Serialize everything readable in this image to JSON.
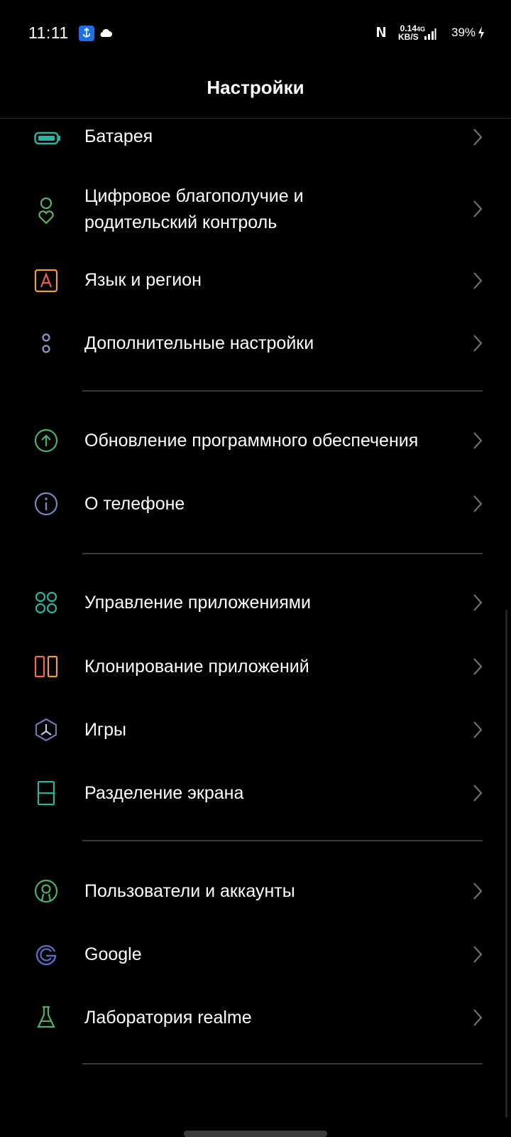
{
  "status_bar": {
    "time": "11:11",
    "net_speed_value": "0.14",
    "net_speed_unit": "KB/S",
    "network_type": "4G",
    "battery": "39%"
  },
  "header": {
    "title": "Настройки"
  },
  "items": [
    {
      "label": "Батарея",
      "icon": "battery-icon",
      "color": "#2bb5a0"
    },
    {
      "label": "Цифровое благополучие и",
      "label2": "родительский контроль",
      "icon": "wellbeing-icon",
      "color": "#5fb06a"
    },
    {
      "label": "Язык и регион",
      "icon": "language-icon",
      "color": "#f0a030"
    },
    {
      "label": "Дополнительные настройки",
      "icon": "more-settings-icon",
      "color": "#8a9ac0"
    },
    {
      "label": "Обновление программного обеспечения",
      "icon": "software-update-icon",
      "color": "#4caf6a"
    },
    {
      "label": "О телефоне",
      "icon": "info-icon",
      "color": "#7a86c0"
    },
    {
      "label": "Управление приложениями",
      "icon": "app-management-icon",
      "color": "#26b5a5"
    },
    {
      "label": "Клонирование приложений",
      "icon": "app-clone-icon",
      "color": "#f07040"
    },
    {
      "label": "Игры",
      "icon": "games-icon",
      "color": "#6a78b0"
    },
    {
      "label": "Разделение экрана",
      "icon": "split-screen-icon",
      "color": "#26b5a5"
    },
    {
      "label": "Пользователи и аккаунты",
      "icon": "users-accounts-icon",
      "color": "#4caf6a"
    },
    {
      "label": "Google",
      "icon": "google-icon",
      "color": "#5c6bc0"
    },
    {
      "label": "Лаборатория realme",
      "icon": "lab-icon",
      "color": "#4caf6a"
    }
  ]
}
